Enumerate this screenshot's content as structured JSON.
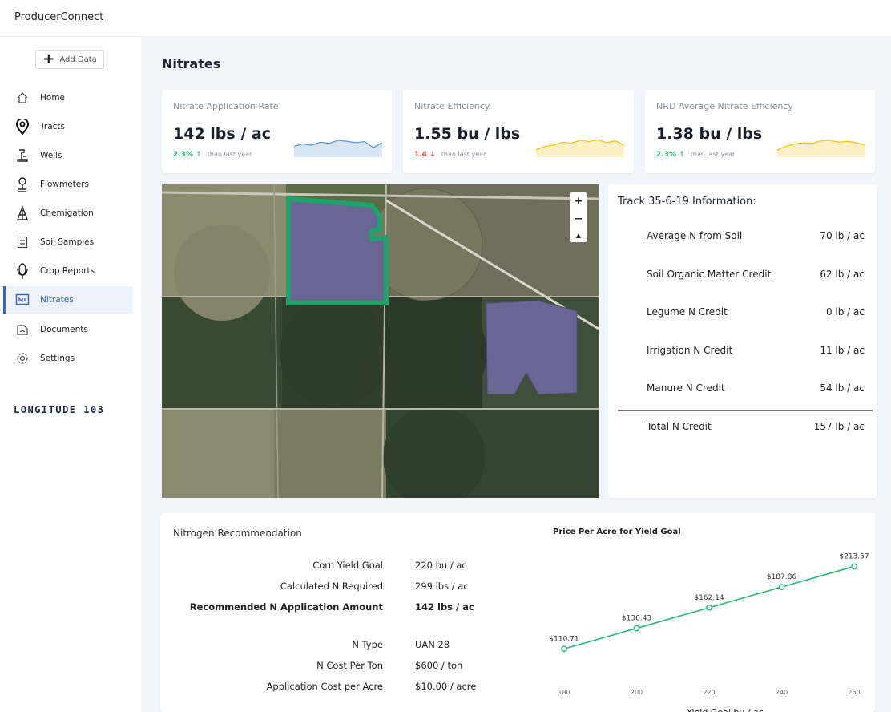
{
  "app": {
    "title": "ProducerConnect"
  },
  "sidebar": {
    "add_label": "Add Data",
    "items": [
      {
        "label": "Home",
        "icon": "home-icon"
      },
      {
        "label": "Tracts",
        "icon": "map-pin-icon"
      },
      {
        "label": "Wells",
        "icon": "well-icon"
      },
      {
        "label": "Flowmeters",
        "icon": "flowmeter-icon"
      },
      {
        "label": "Chemigation",
        "icon": "chemigation-icon"
      },
      {
        "label": "Soil Samples",
        "icon": "soil-sample-icon"
      },
      {
        "label": "Crop Reports",
        "icon": "corn-icon"
      },
      {
        "label": "Nitrates",
        "icon": "nitrates-icon",
        "active": true
      },
      {
        "label": "Documents",
        "icon": "documents-icon"
      },
      {
        "label": "Settings",
        "icon": "gear-icon"
      }
    ],
    "brand": "LONGITUDE 103",
    "accent": "#2f63d6"
  },
  "page": {
    "title": "Nitrates"
  },
  "stats": [
    {
      "title": "Nitrate Application Rate",
      "value": "142 lbs / ac",
      "delta": "2.3%",
      "arrow": "↑",
      "suffix": "than last year",
      "trend": "up",
      "spark": [
        0.45,
        0.55,
        0.5,
        0.62,
        0.58,
        0.7,
        0.66,
        0.6,
        0.65,
        0.4,
        0.6
      ],
      "spark_color": "#5b9bd5"
    },
    {
      "title": "Nitrate Efficiency",
      "value": "1.55 bu / lbs",
      "delta": "1.4",
      "arrow": "↓",
      "suffix": "than last year",
      "trend": "down",
      "spark": [
        0.3,
        0.45,
        0.5,
        0.62,
        0.58,
        0.7,
        0.65,
        0.72,
        0.6,
        0.68,
        0.5
      ],
      "spark_color": "#f5c518"
    },
    {
      "title": "NRD Average Nitrate Efficiency",
      "value": "1.38 bu / lbs",
      "delta": "2.3%",
      "arrow": "↑",
      "suffix": "than last year",
      "trend": "up",
      "spark": [
        0.3,
        0.45,
        0.55,
        0.6,
        0.58,
        0.68,
        0.7,
        0.62,
        0.66,
        0.6,
        0.5
      ],
      "spark_color": "#f5c518"
    }
  ],
  "map": {
    "zoom_in": "+",
    "zoom_out": "−",
    "compass": "▲"
  },
  "tract_info": {
    "title": "Track 35-6-19 Information:",
    "rows": [
      {
        "label": "Average N from Soil",
        "value": "70 lb / ac"
      },
      {
        "label": "Soil Organic Matter Credit",
        "value": "62 lb / ac"
      },
      {
        "label": "Legume N Credit",
        "value": "0 lb / ac"
      },
      {
        "label": "Irrigation N Credit",
        "value": "11 lb / ac"
      },
      {
        "label": "Manure N Credit",
        "value": "54 lb / ac"
      }
    ],
    "total": {
      "label": "Total N Credit",
      "value": "157 lb / ac"
    }
  },
  "recommendation": {
    "title": "Nitrogen Recommendation",
    "rows": [
      {
        "label": "Corn Yield Goal",
        "value": "220  bu / ac",
        "bold": false
      },
      {
        "label": "Calculated N Required",
        "value": "299 lbs / ac",
        "bold": false
      },
      {
        "label": "Recommended N Application Amount",
        "value": "142 lbs / ac",
        "bold": true
      },
      {
        "label": "N Type",
        "value": "UAN 28",
        "bold": false
      },
      {
        "label": "N Cost Per Ton",
        "value": "$600 / ton",
        "bold": false
      },
      {
        "label": "Application Cost per Acre",
        "value": "$10.00 / acre",
        "bold": false
      }
    ]
  },
  "chart_data": {
    "type": "line",
    "title": "Price Per Acre for Yield Goal",
    "xlabel": "Yield Goal bu / ac",
    "ylabel": "",
    "x": [
      180,
      200,
      220,
      240,
      260
    ],
    "series": [
      {
        "values": [
          110.71,
          136.43,
          162.14,
          187.86,
          213.57
        ],
        "labels": [
          "$110.71",
          "$136.43",
          "$162.14",
          "$187.86",
          "$213.57"
        ]
      }
    ],
    "ylim": [
      100,
      220
    ],
    "grid": false,
    "color": "#2bb673"
  }
}
